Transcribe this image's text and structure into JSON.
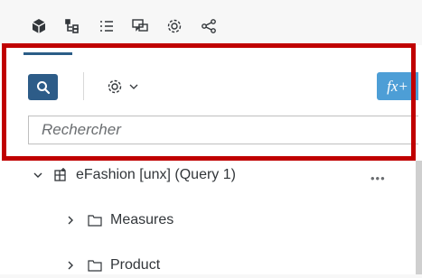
{
  "toolbar": {
    "icons": [
      "cube-icon",
      "hierarchy-icon",
      "list-icon",
      "comments-icon",
      "settings-icon",
      "share-icon"
    ]
  },
  "panel": {
    "fx_label": "fx+",
    "search": {
      "placeholder": "Rechercher",
      "value": ""
    }
  },
  "tree": {
    "root": {
      "label": "eFashion [unx] (Query 1)",
      "expanded": true
    },
    "children": [
      {
        "label": "Measures",
        "expanded": false
      },
      {
        "label": "Product",
        "expanded": false
      }
    ]
  },
  "colors": {
    "accent": "#2d5c88",
    "fx": "#4d9ed6",
    "highlight": "#c00000"
  }
}
